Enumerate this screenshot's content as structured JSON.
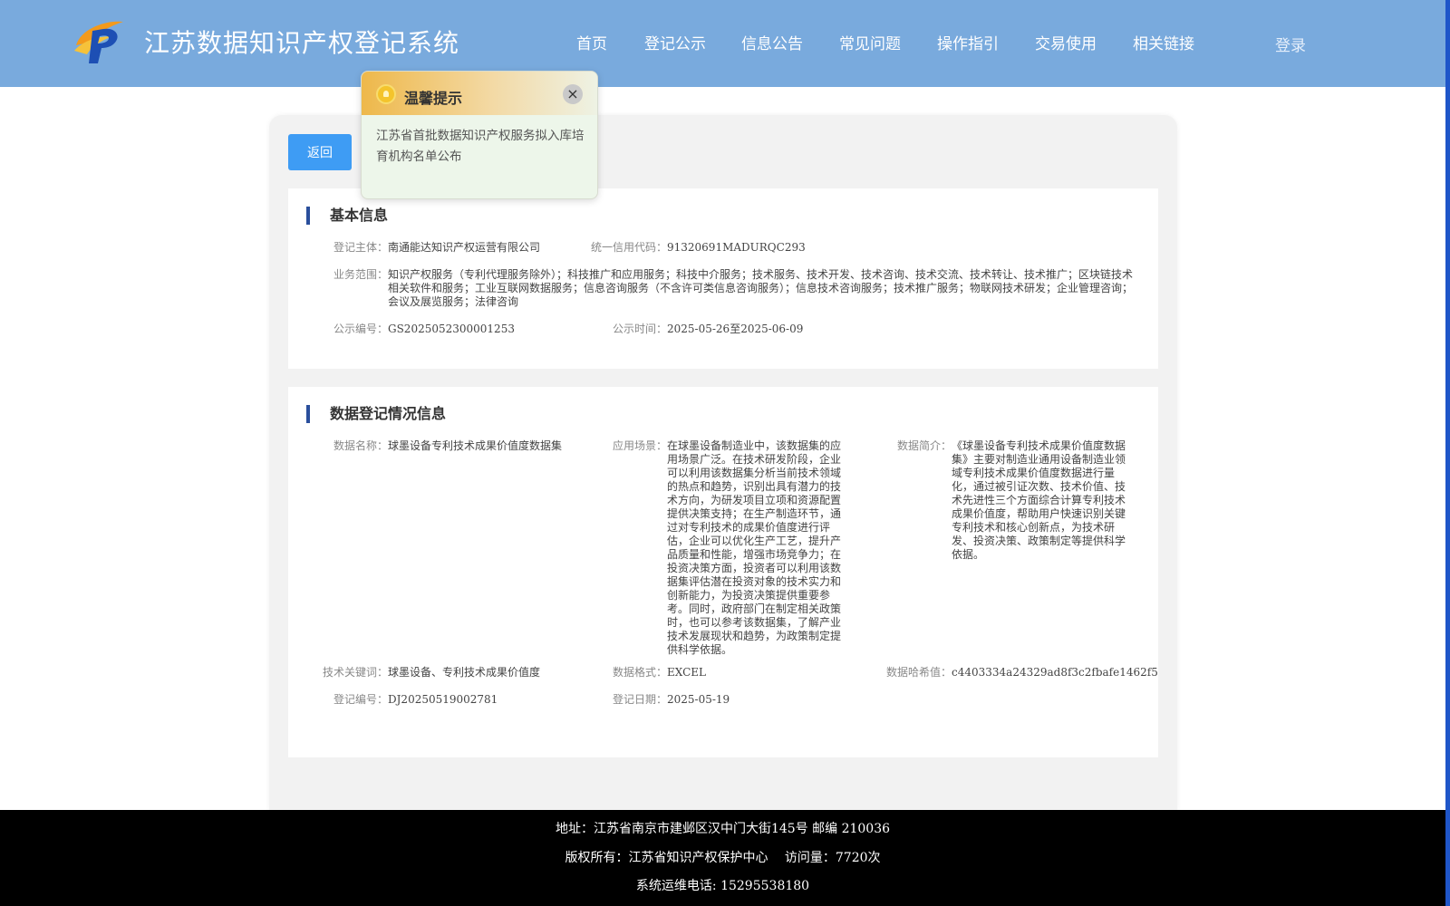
{
  "header": {
    "site_title": "江苏数据知识产权登记系统",
    "nav": [
      "首页",
      "登记公示",
      "信息公告",
      "常见问题",
      "操作指引",
      "交易使用",
      "相关链接"
    ],
    "login": "登录"
  },
  "back_button": "返回",
  "popup": {
    "title": "温馨提示",
    "close_icon": "×",
    "body": "江苏省首批数据知识产权服务拟入库培育机构名单公布"
  },
  "basic_info": {
    "title": "基本信息",
    "subject_label": "登记主体：",
    "subject": "南通能达知识产权运营有限公司",
    "credit_code_label": "统一信用代码：",
    "credit_code": "91320691MADURQC293",
    "scope_label": "业务范围：",
    "scope": "知识产权服务（专利代理服务除外）；科技推广和应用服务；科技中介服务；技术服务、技术开发、技术咨询、技术交流、技术转让、技术推广；区块链技术相关软件和服务；工业互联网数据服务；信息咨询服务（不含许可类信息咨询服务）；信息技术咨询服务；技术推广服务；物联网技术研发；企业管理咨询；会议及展览服务；法律咨询",
    "pub_no_label": "公示编号：",
    "pub_no": "GS2025052300001253",
    "pub_time_label": "公示时间：",
    "pub_time": "2025-05-26至2025-06-09"
  },
  "data_info": {
    "title": "数据登记情况信息",
    "name_label": "数据名称：",
    "name": "球墨设备专利技术成果价值度数据集",
    "scene_label": "应用场景：",
    "scene": "在球墨设备制造业中，该数据集的应用场景广泛。在技术研发阶段，企业可以利用该数据集分析当前技术领域的热点和趋势，识别出具有潜力的技术方向，为研发项目立项和资源配置提供决策支持；在生产制造环节，通过对专利技术的成果价值度进行评估，企业可以优化生产工艺，提升产品质量和性能，增强市场竞争力；在投资决策方面，投资者可以利用该数据集评估潜在投资对象的技术实力和创新能力，为投资决策提供重要参考。同时，政府部门在制定相关政策时，也可以参考该数据集，了解产业技术发展现状和趋势，为政策制定提供科学依据。",
    "intro_label": "数据简介：",
    "intro": "《球墨设备专利技术成果价值度数据集》主要对制造业通用设备制造业领域专利技术成果价值度数据进行量化，通过被引证次数、技术价值、技术先进性三个方面综合计算专利技术成果价值度，帮助用户快速识别关键专利技术和核心创新点，为技术研发、投资决策、政策制定等提供科学依据。",
    "keywords_label": "技术关键词：",
    "keywords": "球墨设备、专利技术成果价值度",
    "format_label": "数据格式：",
    "format": "EXCEL",
    "hash_label": "数据哈希值：",
    "hash": "c4403334a24329ad8f3c2fbafe1462f5",
    "reg_no_label": "登记编号：",
    "reg_no": "DJ20250519002781",
    "reg_date_label": "登记日期：",
    "reg_date": "2025-05-19"
  },
  "footer": {
    "address": "地址：江苏省南京市建邺区汉中门大街145号 邮编 210036",
    "copyright": "版权所有：江苏省知识产权保护中心　 访问量：7720次",
    "phone": "系统运维电话: 15295538180"
  },
  "colors": {
    "header_bg": "#79aadd",
    "back_button": "#3e9cf4",
    "title_bar": "#2a4f9c",
    "footer_bg": "#000000"
  }
}
